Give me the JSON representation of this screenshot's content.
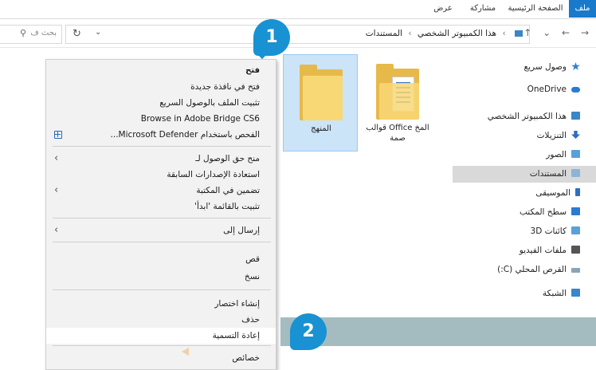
{
  "ribbon": {
    "tabs": [
      {
        "label": "ملف"
      },
      {
        "label": "الصفحة الرئيسية"
      },
      {
        "label": "مشاركة"
      },
      {
        "label": "عرض"
      }
    ]
  },
  "addressbar": {
    "path": [
      "هذا الكمبيوتر الشخصي",
      "المستندات"
    ],
    "separator": "›",
    "search_placeholder": "بحث ف"
  },
  "navpane": {
    "items": [
      {
        "label": "وصول سريع",
        "icon": "star-icon",
        "color": "#2f7fd6"
      },
      {
        "label": "OneDrive",
        "icon": "cloud-icon",
        "color": "#2a7bd6"
      },
      {
        "label": "هذا الكمبيوتر الشخصي",
        "icon": "computer-icon",
        "color": "#3a86c8"
      },
      {
        "label": "التنزيلات",
        "icon": "download-icon",
        "color": "#2b6fc2"
      },
      {
        "label": "الصور",
        "icon": "pictures-icon",
        "color": "#5aa1d8"
      },
      {
        "label": "المستندات",
        "icon": "documents-icon",
        "color": "#8fb3d8"
      },
      {
        "label": "الموسيقى",
        "icon": "music-icon",
        "color": "#2b6fc2"
      },
      {
        "label": "سطح المكتب",
        "icon": "desktop-icon",
        "color": "#2a7bd6"
      },
      {
        "label": "كائنات 3D",
        "icon": "3d-objects-icon",
        "color": "#5aa1d8"
      },
      {
        "label": "ملفات الفيديو",
        "icon": "video-icon",
        "color": "#555555"
      },
      {
        "label": "القرص المحلي (C:)",
        "icon": "drive-icon",
        "color": "#8aa3b8"
      },
      {
        "label": "الشبكة",
        "icon": "network-icon",
        "color": "#3a86c8"
      }
    ],
    "selected": "المستندات"
  },
  "files": [
    {
      "name": "المخ Office قوالب صمة",
      "icon": "folder-with-documents-icon"
    },
    {
      "name": "المنهج",
      "icon": "folder-icon",
      "selected": true
    }
  ],
  "context_menu": {
    "items": [
      {
        "label": "فتح",
        "bold": true
      },
      {
        "label": "فتح في نافذة جديدة"
      },
      {
        "label": "تثبيت الملف بالوصول السريع"
      },
      {
        "label": "Browse in Adobe Bridge CS6"
      },
      {
        "label": "الفحص باستخدام Microsoft Defender...",
        "icon": "defender-icon"
      },
      {
        "label": "منح حق الوصول لـ",
        "submenu": true
      },
      {
        "label": "استعادة الإصدارات السابقة"
      },
      {
        "label": "تضمين في المكتبة",
        "submenu": true
      },
      {
        "label": "تثبيت بالقائمة 'ابدأ'"
      },
      {
        "label": "إرسال إلى",
        "submenu": true
      },
      {
        "label": "قص"
      },
      {
        "label": "نسخ"
      },
      {
        "label": "إنشاء اختصار"
      },
      {
        "label": "حذف"
      },
      {
        "label": "إعادة التسمية",
        "highlighted": true
      },
      {
        "label": "خصائص"
      }
    ],
    "submenu_arrow": "‹"
  },
  "callouts": {
    "step1": "1",
    "step2": "2"
  },
  "colors": {
    "accent": "#1979ca",
    "badge": "#1892d2",
    "banner": "#9fb8bd",
    "selection": "#cce4f7"
  }
}
